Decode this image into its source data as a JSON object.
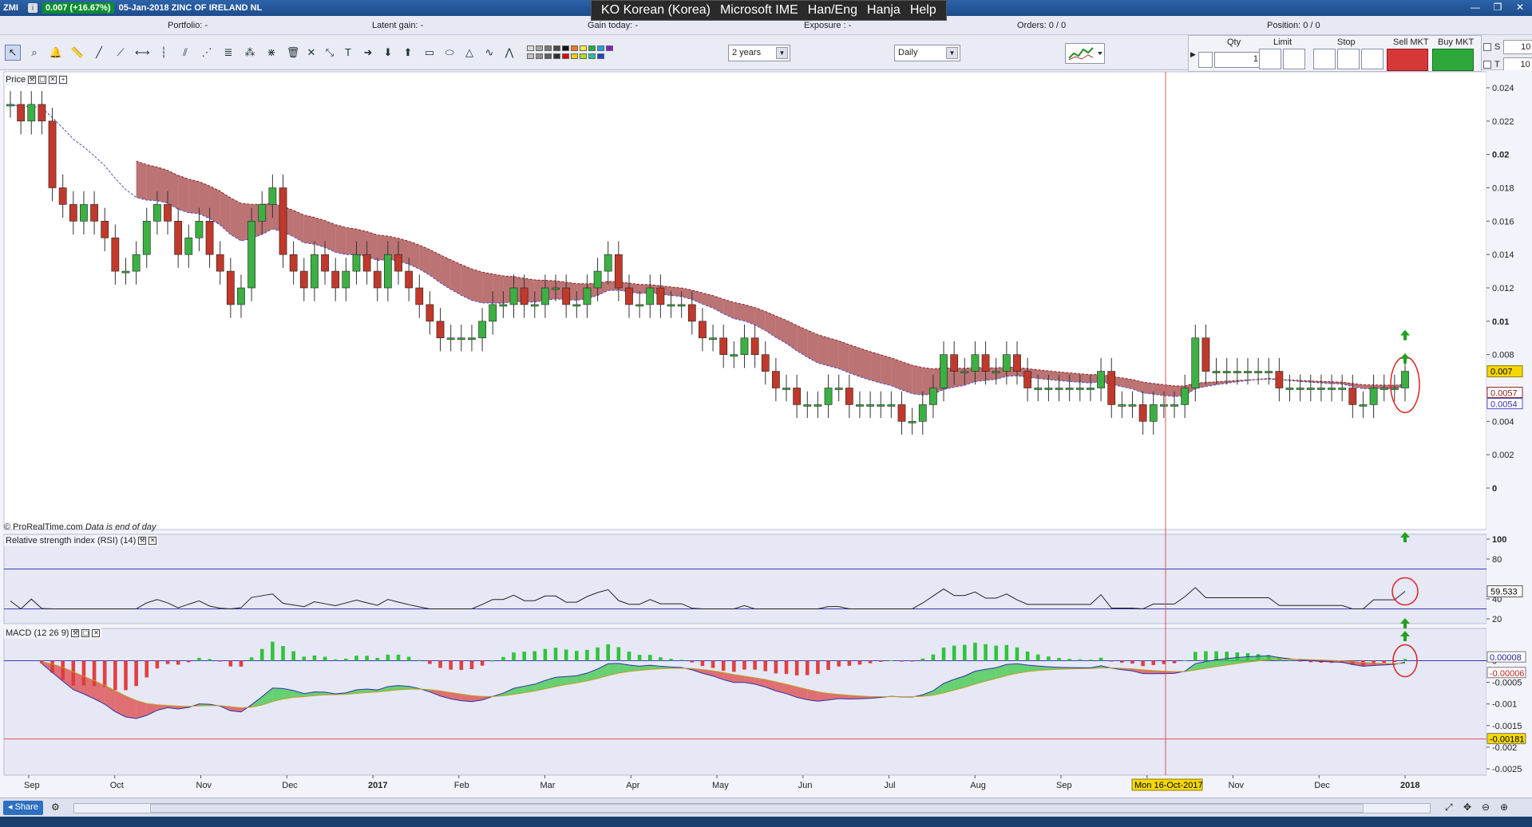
{
  "window": {
    "symbol": "ZMI",
    "price_change": "0.007 (+16.67%)",
    "description": "05-Jan-2018 ZINC OF IRELAND NL"
  },
  "ime": {
    "items": [
      "KO Korean (Korea)",
      "Microsoft IME",
      "Han/Eng",
      "Hanja",
      "Help"
    ]
  },
  "portfolio_bar": {
    "portfolio": "Portfolio: -",
    "latent_gain": "Latent gain: -",
    "gain_today": "Gain today: -",
    "exposure": "Exposure : -",
    "orders": "Orders: 0 / 0",
    "position": "Position: 0 / 0"
  },
  "toolbar": {
    "period": "2 years",
    "interval": "Daily",
    "swatch_colors": [
      "#d8d8d8",
      "#c0c0c0",
      "#a8a8a8",
      "#909090",
      "#787878",
      "#606060",
      "#484848",
      "#303030",
      "#101010",
      "#e00000",
      "#f07820",
      "#f0d000",
      "#f8f040",
      "#a8e020",
      "#20b040",
      "#20c0a0",
      "#20a0e0",
      "#2040d0",
      "#8020c0"
    ]
  },
  "order_panel": {
    "qty_label": "Qty",
    "qty_value": "1",
    "limit_label": "Limit",
    "stop_label": "Stop",
    "sell_label": "Sell MKT",
    "buy_label": "Buy MKT",
    "s_label": "S",
    "s_value": "10",
    "t_label": "T",
    "t_value": "10"
  },
  "panels": {
    "price_title": "Price",
    "rsi_title": "Relative strength index (RSI) (14)",
    "macd_title": "MACD (12 26 9)",
    "credit": "© ProRealTime.com",
    "credit_note": "Data is end of day"
  },
  "cursor": {
    "date_label": "Mon 16-Oct-2017"
  },
  "bottom": {
    "share_label": "Share"
  },
  "chart_data": [
    {
      "type": "candlestick",
      "panel": "price",
      "ylim": [
        0,
        0.024
      ],
      "y_ticks": [
        0,
        0.002,
        0.004,
        0.006,
        0.008,
        0.01,
        0.012,
        0.014,
        0.016,
        0.018,
        0.02,
        0.022,
        0.024
      ],
      "y_tick_labels": [
        "0",
        "0.002",
        "0.004",
        "",
        "0.008",
        "0.01",
        "0.012",
        "0.014",
        "0.016",
        "0.018",
        "0.02",
        "0.022",
        "0.024"
      ],
      "x_labels": [
        "Sep",
        "Oct",
        "Nov",
        "Dec",
        "2017",
        "Feb",
        "Mar",
        "Apr",
        "May",
        "Jun",
        "Jul",
        "Aug",
        "Sep",
        "O",
        "Nov",
        "Dec",
        "2018"
      ],
      "last_price_label": "0.007",
      "indicator_labels": [
        "0.0057",
        "0.0054"
      ],
      "close_series": [
        0.023,
        0.022,
        0.023,
        0.022,
        0.018,
        0.017,
        0.016,
        0.017,
        0.016,
        0.015,
        0.013,
        0.013,
        0.014,
        0.016,
        0.017,
        0.016,
        0.014,
        0.015,
        0.016,
        0.014,
        0.013,
        0.011,
        0.012,
        0.016,
        0.017,
        0.018,
        0.014,
        0.013,
        0.012,
        0.014,
        0.013,
        0.012,
        0.013,
        0.014,
        0.013,
        0.012,
        0.014,
        0.013,
        0.012,
        0.011,
        0.01,
        0.009,
        0.009,
        0.009,
        0.009,
        0.01,
        0.011,
        0.011,
        0.012,
        0.011,
        0.011,
        0.012,
        0.012,
        0.011,
        0.011,
        0.012,
        0.013,
        0.014,
        0.012,
        0.011,
        0.011,
        0.012,
        0.011,
        0.011,
        0.011,
        0.01,
        0.009,
        0.009,
        0.008,
        0.008,
        0.009,
        0.008,
        0.007,
        0.006,
        0.006,
        0.005,
        0.005,
        0.005,
        0.006,
        0.006,
        0.005,
        0.005,
        0.005,
        0.005,
        0.005,
        0.004,
        0.004,
        0.005,
        0.006,
        0.008,
        0.007,
        0.007,
        0.008,
        0.007,
        0.007,
        0.008,
        0.007,
        0.006,
        0.006,
        0.006,
        0.006,
        0.006,
        0.006,
        0.006,
        0.007,
        0.005,
        0.005,
        0.005,
        0.004,
        0.005,
        0.005,
        0.005,
        0.006,
        0.009,
        0.007,
        0.007,
        0.007,
        0.007,
        0.007,
        0.007,
        0.007,
        0.006,
        0.006,
        0.006,
        0.006,
        0.006,
        0.006,
        0.006,
        0.005,
        0.005,
        0.006,
        0.006,
        0.006,
        0.007
      ]
    },
    {
      "type": "line",
      "panel": "rsi",
      "ylim": [
        20,
        100
      ],
      "y_ticks": [
        20,
        40,
        80,
        100
      ],
      "levels": [
        70,
        30
      ],
      "last_value_label": "59.533"
    },
    {
      "type": "bar",
      "panel": "macd",
      "ylim": [
        -0.0025,
        0.0006
      ],
      "y_ticks": [
        0,
        -0.0005,
        -0.001,
        -0.0015,
        -0.002,
        -0.0025
      ],
      "y_tick_labels": [
        "0",
        "-0.0005",
        "-0.001",
        "-0.0015",
        "-0.002",
        "-0.0025"
      ],
      "value_labels": [
        "0.00008",
        "-0.00006",
        "-0.00181"
      ],
      "reference_level": -0.00181
    }
  ]
}
